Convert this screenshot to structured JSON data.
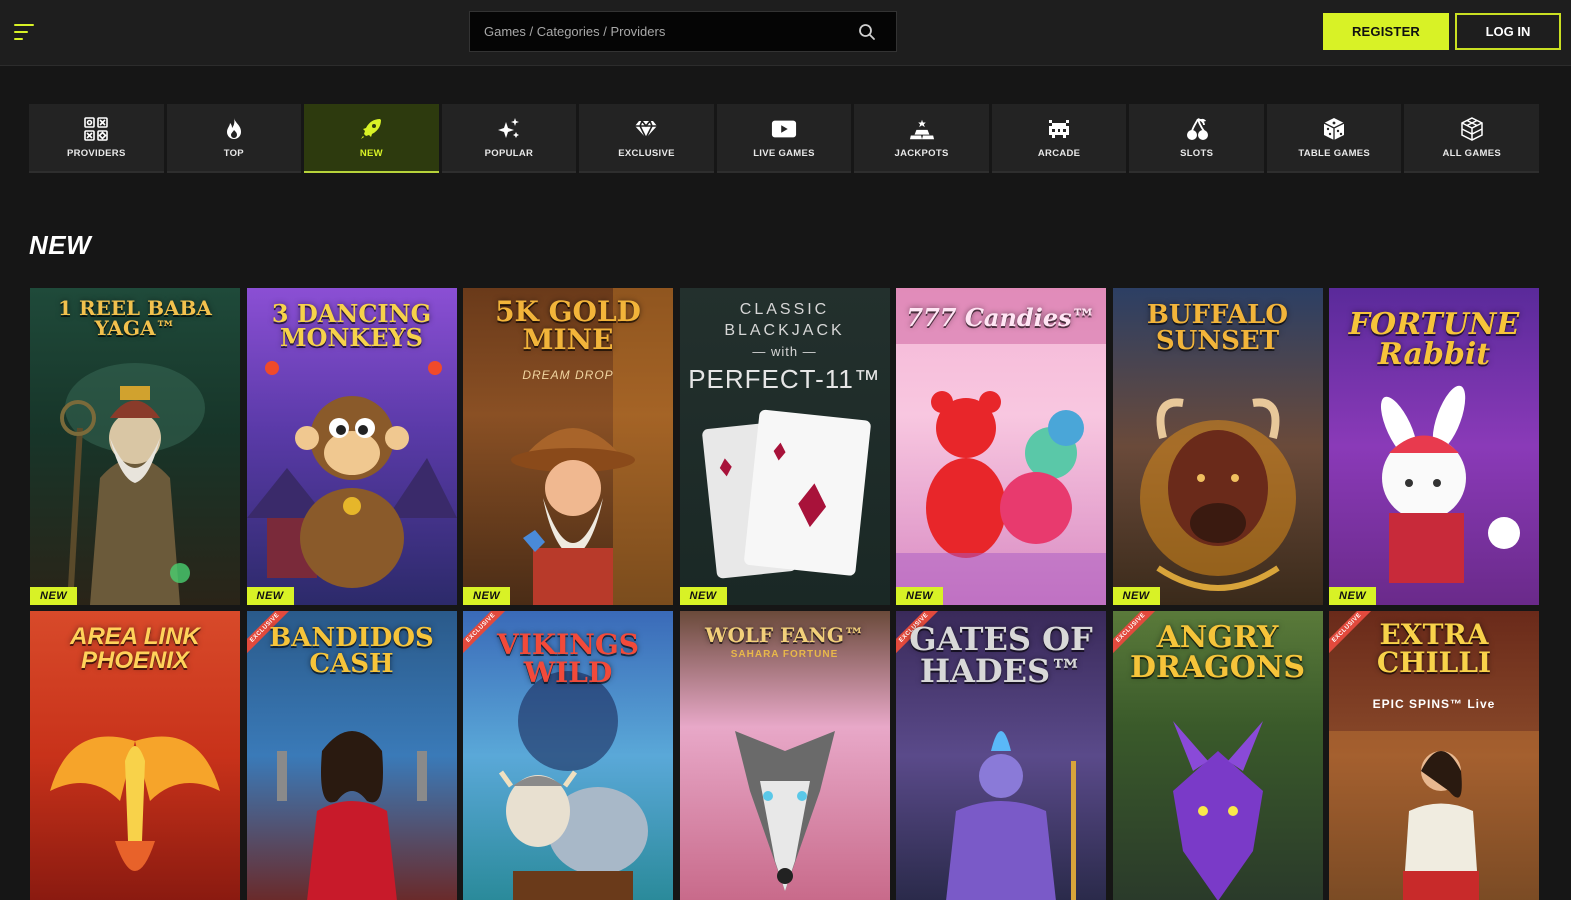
{
  "header": {
    "search_placeholder": "Games / Categories / Providers",
    "register_label": "REGISTER",
    "login_label": "LOG IN",
    "accent": "#d8f226"
  },
  "categories": [
    {
      "label": "PROVIDERS",
      "icon": "providers-icon",
      "active": false
    },
    {
      "label": "TOP",
      "icon": "flame-icon",
      "active": false
    },
    {
      "label": "NEW",
      "icon": "rocket-icon",
      "active": true
    },
    {
      "label": "POPULAR",
      "icon": "sparkles-icon",
      "active": false
    },
    {
      "label": "EXCLUSIVE",
      "icon": "diamond-icon",
      "active": false
    },
    {
      "label": "LIVE GAMES",
      "icon": "play-icon",
      "active": false
    },
    {
      "label": "JACKPOTS",
      "icon": "gold-bars-icon",
      "active": false
    },
    {
      "label": "ARCADE",
      "icon": "space-invader-icon",
      "active": false
    },
    {
      "label": "SLOTS",
      "icon": "cherries-icon",
      "active": false
    },
    {
      "label": "TABLE GAMES",
      "icon": "dice-icon",
      "active": false
    },
    {
      "label": "ALL GAMES",
      "icon": "cubes-icon",
      "active": false
    }
  ],
  "section_title": "NEW",
  "badge_new": "NEW",
  "ribbon_exclusive": "EXCLUSIVE",
  "games_row1": [
    {
      "title": "1 REEL BABA YAGA™",
      "badge": "NEW"
    },
    {
      "title": "3 DANCING MONKEYS",
      "badge": "NEW"
    },
    {
      "title": "5K GOLD MINE",
      "subtitle": "DREAM DROP",
      "badge": "NEW"
    },
    {
      "title": "PERFECT-11™",
      "supertitle": "CLASSIC BLACKJACK",
      "with": "— with —",
      "badge": "NEW"
    },
    {
      "title": "777 Candies™",
      "badge": "NEW"
    },
    {
      "title": "BUFFALO SUNSET",
      "badge": "NEW"
    },
    {
      "title": "FORTUNE Rabbit",
      "badge": "NEW"
    }
  ],
  "games_row2": [
    {
      "title": "AREA LINK PHOENIX",
      "exclusive": false
    },
    {
      "title": "BANDIDOS CASH",
      "exclusive": true
    },
    {
      "title": "VIKINGS WILD",
      "exclusive": true
    },
    {
      "title": "WOLF FANG™",
      "subtitle": "SAHARA FORTUNE",
      "exclusive": false
    },
    {
      "title": "GATES OF HADES™",
      "exclusive": true
    },
    {
      "title": "ANGRY DRAGONS",
      "exclusive": true
    },
    {
      "title": "EXTRA CHILLI",
      "subtitle": "EPIC SPINS™ Live",
      "exclusive": true
    }
  ]
}
